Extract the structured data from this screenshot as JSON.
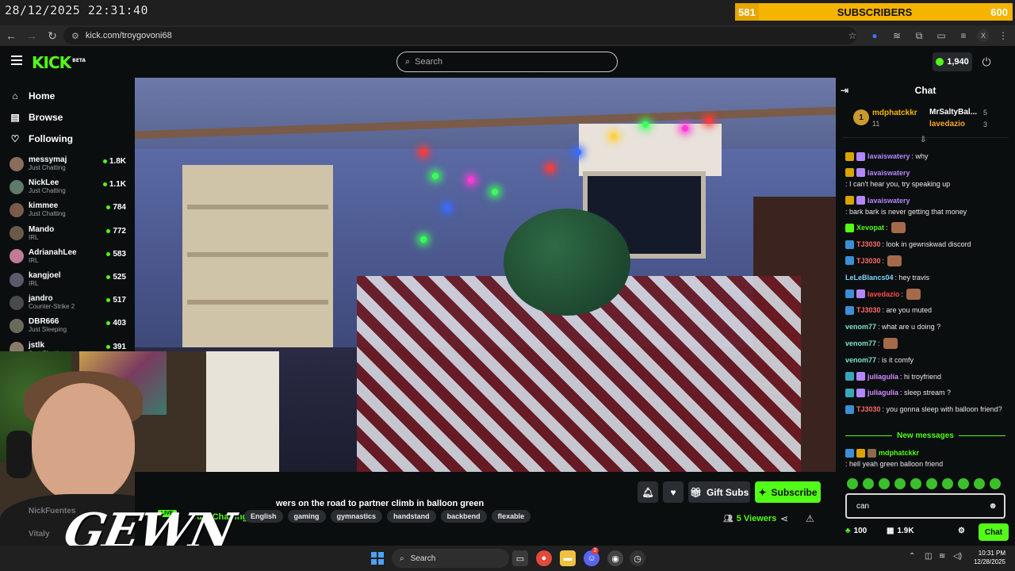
{
  "overlay": {
    "clock": "28/12/2025 22:31:40",
    "sub_goal": {
      "current": "581",
      "label": "SUBSCRIBERS",
      "target": "600",
      "progress": 0.968
    }
  },
  "browser": {
    "url": "kick.com/troygovoni68",
    "profile_initial": "X"
  },
  "header": {
    "logo": "KICK",
    "logo_sup": "BETA",
    "search_placeholder": "Search",
    "kicks_balance": "1,940"
  },
  "sidebar": {
    "nav": [
      {
        "label": "Home",
        "icon": "home-icon"
      },
      {
        "label": "Browse",
        "icon": "browse-icon"
      },
      {
        "label": "Following",
        "icon": "heart-icon"
      }
    ],
    "following": [
      {
        "name": "messymaj",
        "category": "Just Chatting",
        "viewers": "1.8K",
        "color": "#8a6d5a"
      },
      {
        "name": "NickLee",
        "category": "Just Chatting",
        "viewers": "1.1K",
        "color": "#5d7a6a"
      },
      {
        "name": "kimmee",
        "category": "Just Chatting",
        "viewers": "784",
        "color": "#7a5a4a"
      },
      {
        "name": "Mando",
        "category": "IRL",
        "viewers": "772",
        "color": "#6a5a4a"
      },
      {
        "name": "AdrianahLee",
        "category": "IRL",
        "viewers": "583",
        "color": "#c07a9a"
      },
      {
        "name": "kangjoel",
        "category": "IRL",
        "viewers": "525",
        "color": "#5a5a6a"
      },
      {
        "name": "jandro",
        "category": "Counter-Strike 2",
        "viewers": "517",
        "color": "#4a4a4a"
      },
      {
        "name": "DBR666",
        "category": "Just Sleeping",
        "viewers": "403",
        "color": "#6a6a5a"
      },
      {
        "name": "jstlk",
        "category": "Just Chatting",
        "viewers": "391",
        "color": "#8a7a6a"
      }
    ],
    "background_names": [
      "NickFuentes",
      "Vitaly"
    ]
  },
  "stream": {
    "title": "wers on the road to partner climb in balloon green",
    "live_label": "LIVE",
    "category": "Just Chatting",
    "tags": [
      "English",
      "gaming",
      "gymnastics",
      "handstand",
      "backbend",
      "flexable"
    ],
    "viewers": "5 Viewers",
    "gift_subs_label": "Gift Subs",
    "subscribe_label": "Subscribe",
    "webcam_logo": "GEWN"
  },
  "chat": {
    "title": "Chat",
    "leaderboard": [
      {
        "rank": "1",
        "name": "mdphatckkr",
        "count": "11",
        "color": "#f5b400"
      },
      {
        "name": "MrSaltyBal...",
        "count": "5",
        "color": "#ffffff"
      },
      {
        "name": "lavedazio",
        "count": "3",
        "color": "#f5a623"
      }
    ],
    "messages": [
      {
        "user": "lavaiswatery",
        "color": "#b387ff",
        "text": ": why",
        "badges": [
          "#d9a400",
          "#b387ff"
        ]
      },
      {
        "user": "lavaiswatery",
        "color": "#b387ff",
        "text": ": I can't hear you, try speaking up",
        "badges": [
          "#d9a400",
          "#b387ff"
        ]
      },
      {
        "user": "lavaiswatery",
        "color": "#b387ff",
        "text": ": bark bark is never getting that money",
        "badges": [
          "#d9a400",
          "#b387ff"
        ]
      },
      {
        "user": "Xevopat",
        "color": "#53fc18",
        "text": ":",
        "badges": [
          "#53fc18"
        ],
        "emote": true
      },
      {
        "user": "TJ3030",
        "color": "#ff6b6b",
        "text": ": look in gewnskwad discord",
        "badges": [
          "#3a8fd6"
        ]
      },
      {
        "user": "TJ3030",
        "color": "#ff6b6b",
        "text": ":",
        "badges": [
          "#3a8fd6"
        ],
        "emote": true
      },
      {
        "user": "LeLeBlancs04",
        "color": "#7fd3ff",
        "text": ": hey travis",
        "badges": []
      },
      {
        "user": "lavedazio",
        "color": "#ff4a4a",
        "text": ":",
        "badges": [
          "#3a8fd6",
          "#b387ff"
        ],
        "emote": true
      },
      {
        "user": "TJ3030",
        "color": "#ff6b6b",
        "text": ": are you muted",
        "badges": [
          "#3a8fd6"
        ]
      },
      {
        "user": "venom77",
        "color": "#7fe3c8",
        "text": ": what are u doing ?",
        "badges": []
      },
      {
        "user": "venom77",
        "color": "#7fe3c8",
        "text": ":",
        "badges": [],
        "emote": true
      },
      {
        "user": "venom77",
        "color": "#7fe3c8",
        "text": ": is it comfy",
        "badges": []
      },
      {
        "user": "juliagulia",
        "color": "#d08cff",
        "text": ": hi troyfriend",
        "badges": [
          "#3aa6b8",
          "#b387ff"
        ]
      },
      {
        "user": "juliagulia",
        "color": "#d08cff",
        "text": ": sleep stream ?",
        "badges": [
          "#3aa6b8",
          "#b387ff"
        ]
      },
      {
        "user": "TJ3030",
        "color": "#ff6b6b",
        "text": ": you gonna sleep with balloon friend?",
        "badges": [
          "#3a8fd6"
        ]
      }
    ],
    "new_messages_label": "New messages",
    "latest_message": {
      "user": "mdphatckkr",
      "color": "#53fc18",
      "text": ": hell yeah green balloon friend",
      "badges": [
        "#3a8fd6",
        "#d9a400",
        "#8a6a4a"
      ]
    },
    "input_value": "can",
    "kicks_count": "100",
    "points": "1.9K",
    "send_label": "Chat"
  },
  "taskbar": {
    "search_label": "Search",
    "discord_badge": "2",
    "time": "10:31 PM",
    "date": "12/28/2025"
  }
}
